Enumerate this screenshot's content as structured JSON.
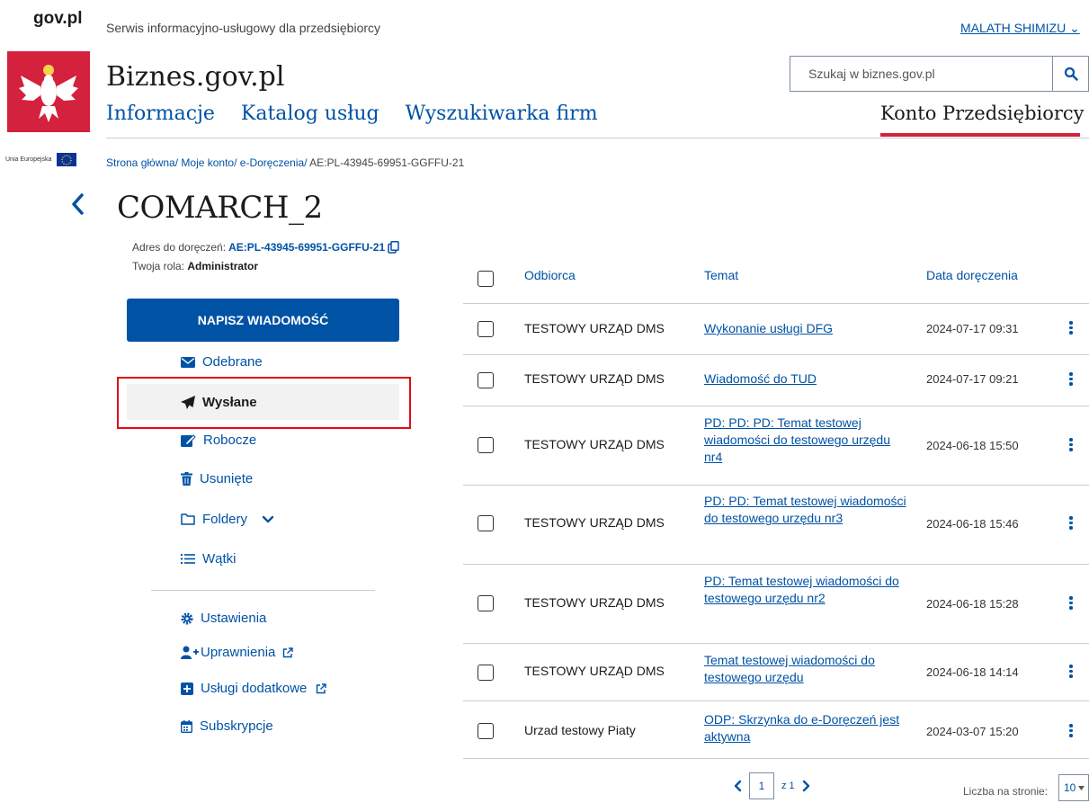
{
  "header": {
    "gov_logo": "gov.pl",
    "tagline": "Serwis informacyjno-usługowy dla przedsiębiorcy",
    "user_name": "MALATH SHIMIZU",
    "eu_label": "Unia Europejska",
    "site_name": "Biznes.gov.pl",
    "search_placeholder": "Szukaj w biznes.gov.pl",
    "nav": [
      "Informacje",
      "Katalog usług",
      "Wyszukiwarka firm"
    ],
    "account_tab": "Konto Przedsiębiorcy",
    "brand_red": "#d4213d",
    "link_blue": "#0052a5"
  },
  "breadcrumb": {
    "items": [
      "Strona główna/",
      "Moje konto/",
      "e-Doręczenia/"
    ],
    "current": "AE:PL-43945-69951-GGFFU-21"
  },
  "page": {
    "title": "COMARCH_2",
    "address_label": "Adres do doręczeń: ",
    "address_value": "AE:PL-43945-69951-GGFFU-21",
    "role_label": "Twoja rola: ",
    "role_value": "Administrator"
  },
  "sidebar": {
    "write_button": "NAPISZ WIADOMOŚĆ",
    "items": [
      {
        "label": "Odebrane",
        "icon": "envelope-icon"
      },
      {
        "label": "Wysłane",
        "icon": "paper-plane-icon",
        "active": true
      },
      {
        "label": "Robocze",
        "icon": "edit-icon"
      },
      {
        "label": "Usunięte",
        "icon": "trash-icon"
      },
      {
        "label": "Foldery",
        "icon": "folder-icon"
      },
      {
        "label": "Wątki",
        "icon": "list-icon"
      }
    ],
    "settings": [
      {
        "label": "Ustawienia",
        "icon": "gear-icon"
      },
      {
        "label": "Uprawnienia",
        "icon": "user-plus-icon"
      },
      {
        "label": "Usługi dodatkowe",
        "icon": "plus-square-icon"
      },
      {
        "label": "Subskrypcje",
        "icon": "calendar-icon"
      }
    ]
  },
  "table": {
    "columns": [
      "Odbiorca",
      "Temat",
      "Data doręczenia"
    ],
    "rows": [
      {
        "recipient": "TESTOWY URZĄD DMS",
        "subject": "Wykonanie usługi DFG",
        "date": "2024-07-17 09:31"
      },
      {
        "recipient": "TESTOWY URZĄD DMS",
        "subject": "Wiadomość do TUD",
        "date": "2024-07-17 09:21"
      },
      {
        "recipient": "TESTOWY URZĄD DMS",
        "subject": "PD: PD: PD: Temat testowej wiadomości do testowego urzędu nr4",
        "date": "2024-06-18 15:50"
      },
      {
        "recipient": "TESTOWY URZĄD DMS",
        "subject": "PD: PD: Temat testowej wiadomości do testowego urzędu nr3",
        "date": "2024-06-18 15:46"
      },
      {
        "recipient": "TESTOWY URZĄD DMS",
        "subject": "PD: Temat testowej wiadomości do testowego urzędu nr2",
        "date": "2024-06-18 15:28"
      },
      {
        "recipient": "TESTOWY URZĄD DMS",
        "subject": "Temat testowej wiadomości do testowego urzędu",
        "date": "2024-06-18 14:14"
      },
      {
        "recipient": "Urzad testowy Piaty",
        "subject": "ODP: Skrzynka do e-Doręczeń jest aktywna",
        "date": "2024-03-07 15:20"
      }
    ]
  },
  "pagination": {
    "current_page": "1",
    "total": "z 1",
    "per_page_label": "Liczba na stronie:",
    "per_page_value": "10"
  }
}
